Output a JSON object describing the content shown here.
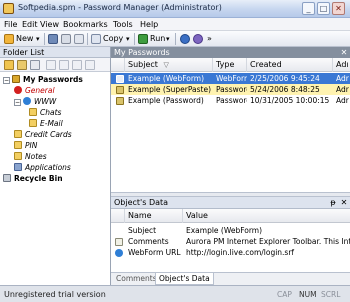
{
  "window": {
    "title": "Softpedia.spm - Password Manager (Administrator)",
    "minimize": "_",
    "maximize": "□",
    "close": "✕"
  },
  "menu": [
    "File",
    "Edit",
    "View",
    "Bookmarks",
    "Tools",
    "Help"
  ],
  "toolbar": {
    "new_label": "New",
    "copy_label": "Copy",
    "run_label": "Run",
    "more_label": "»",
    "dropdown_arrow": "▾"
  },
  "folder_list": {
    "title": "Folder List",
    "tree": [
      {
        "label": "My Passwords",
        "level": 0,
        "bold": true,
        "expander": "−",
        "icon": "key-icon"
      },
      {
        "label": "General",
        "level": 1,
        "italic": true,
        "color": "#c00000",
        "icon": "red-stop-icon"
      },
      {
        "label": "WWW",
        "level": 1,
        "italic": true,
        "expander": "−",
        "icon": "globe-icon"
      },
      {
        "label": "Chats",
        "level": 2,
        "italic": true,
        "icon": "folder-icon"
      },
      {
        "label": "E-Mail",
        "level": 2,
        "italic": true,
        "icon": "folder-icon"
      },
      {
        "label": "Credit Cards",
        "level": 1,
        "italic": true,
        "icon": "folder-icon"
      },
      {
        "label": "PIN",
        "level": 1,
        "italic": true,
        "icon": "folder-icon"
      },
      {
        "label": "Notes",
        "level": 1,
        "italic": true,
        "icon": "folder-icon"
      },
      {
        "label": "Applications",
        "level": 1,
        "italic": true,
        "icon": "application-icon"
      },
      {
        "label": "Recycle Bin",
        "level": 0,
        "bold": true,
        "icon": "recycle-bin-icon"
      }
    ]
  },
  "passwords": {
    "title": "My Passwords",
    "close": "✕",
    "columns": [
      "Subject",
      "Type",
      "Created",
      "Adı"
    ],
    "sort_indicator": "▽",
    "rows": [
      {
        "subject": "Example (WebForm)",
        "type": "WebForm",
        "created": "2/25/2006 9:45:24",
        "extra": "Adr",
        "state": "selected"
      },
      {
        "subject": "Example (SuperPaste)",
        "type": "Password",
        "created": "5/24/2006 8:48:25",
        "extra": "Adr",
        "state": "highlight"
      },
      {
        "subject": "Example (Password)",
        "type": "Password",
        "created": "10/31/2005 10:00:15",
        "extra": "Adr",
        "state": "normal"
      }
    ]
  },
  "objects": {
    "title": "Object's Data",
    "pin": "ᵽ",
    "close": "✕",
    "columns": [
      "Name",
      "Value"
    ],
    "rows": [
      {
        "name": "Subject",
        "value": "Example (WebForm)",
        "icon": ""
      },
      {
        "name": "Comments",
        "value": "Aurora PM Internet Explorer Toolbar. This Internet E",
        "icon": "comment-icon"
      },
      {
        "name": "WebForm URL",
        "value": "http://login.live.com/login.srf",
        "icon": "globe-icon"
      }
    ],
    "tabs": [
      "Comments",
      "Object's Data"
    ]
  },
  "status": {
    "text": "Unregistered trial version",
    "indicators": [
      "CAP",
      "NUM",
      "SCRL"
    ]
  },
  "colors": {
    "selected_row": "#3a78d4",
    "highlight_row": "#fff3b0",
    "header_dark": "#848f9e"
  }
}
